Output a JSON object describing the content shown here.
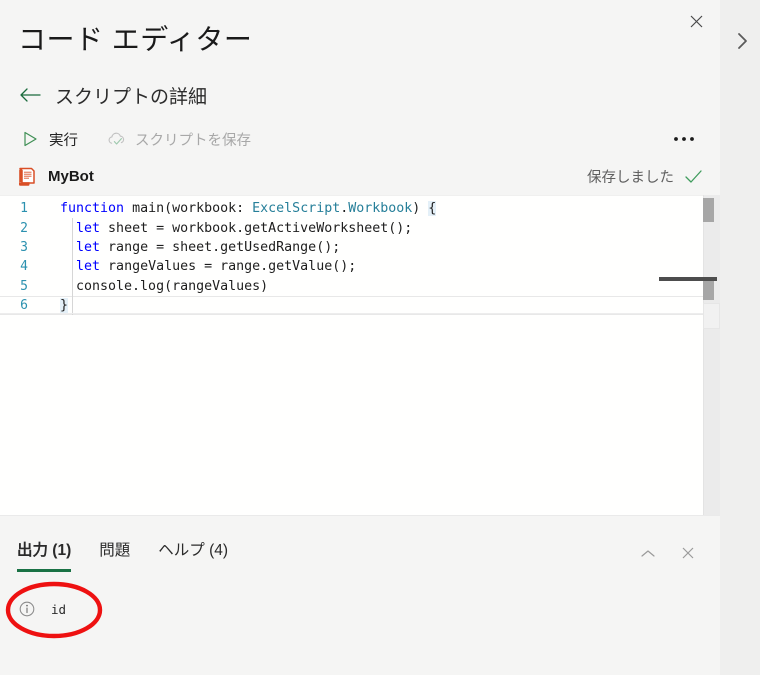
{
  "window": {
    "title": "コード エディター",
    "close_icon": "close-icon"
  },
  "right_rail": {
    "expand_icon": "chevron-right-icon"
  },
  "back_nav": {
    "icon": "arrow-left-icon",
    "label": "スクリプトの詳細"
  },
  "command_bar": {
    "run": {
      "icon": "play-triangle-icon",
      "label": "実行",
      "enabled": true
    },
    "save_script": {
      "icon": "cloud-check-icon",
      "label": "スクリプトを保存",
      "enabled": false
    },
    "overflow": {
      "icon": "ellipsis-icon",
      "label": "•••"
    }
  },
  "script": {
    "icon": "script-document-icon",
    "name": "MyBot",
    "save_state_text": "保存しました",
    "save_state_icon": "checkmark-icon"
  },
  "editor": {
    "language": "typescript",
    "line_numbers": [
      "1",
      "2",
      "3",
      "4",
      "5",
      "6"
    ],
    "lines": [
      {
        "number": "1",
        "tokens": [
          {
            "text": "function ",
            "type": "keyword"
          },
          {
            "text": "main",
            "type": "plain"
          },
          {
            "text": "(workbook: ",
            "type": "plain"
          },
          {
            "text": "ExcelScript",
            "type": "type"
          },
          {
            "text": ".",
            "type": "plain"
          },
          {
            "text": "Workbook",
            "type": "type"
          },
          {
            "text": ") ",
            "type": "plain"
          },
          {
            "text": "{",
            "type": "bracket"
          }
        ]
      },
      {
        "number": "2",
        "tokens": [
          {
            "text": "  ",
            "type": "plain"
          },
          {
            "text": "let",
            "type": "keyword"
          },
          {
            "text": " sheet = workbook.getActiveWorksheet();",
            "type": "plain"
          }
        ]
      },
      {
        "number": "3",
        "tokens": [
          {
            "text": "  ",
            "type": "plain"
          },
          {
            "text": "let",
            "type": "keyword"
          },
          {
            "text": " range = sheet.getUsedRange();",
            "type": "plain"
          }
        ]
      },
      {
        "number": "4",
        "tokens": [
          {
            "text": "  ",
            "type": "plain"
          },
          {
            "text": "let",
            "type": "keyword"
          },
          {
            "text": " rangeValues = range.getValue();",
            "type": "plain"
          }
        ]
      },
      {
        "number": "5",
        "tokens": [
          {
            "text": "  console.log(rangeValues)",
            "type": "plain"
          }
        ]
      },
      {
        "number": "6",
        "tokens": [
          {
            "text": "}",
            "type": "bracket"
          }
        ]
      }
    ]
  },
  "output_panel": {
    "tabs": [
      {
        "label": "出力 (1)",
        "active": true,
        "name": "tab-output"
      },
      {
        "label": "問題",
        "active": false,
        "name": "tab-problems"
      },
      {
        "label": "ヘルプ (4)",
        "active": false,
        "name": "tab-help"
      }
    ],
    "collapse_icon": "chevron-up-icon",
    "close_icon": "close-icon",
    "rows": [
      {
        "icon": "info-circle-icon",
        "text": "id"
      }
    ]
  },
  "annotation": {
    "shape": "ellipse",
    "color": "#ee1111",
    "target": "output-row-id"
  },
  "colors": {
    "accent_green": "#1a7245",
    "panel_bg": "#f5f5f4",
    "editor_bg": "#fffffe",
    "rail_bg": "#efefee",
    "keyword_blue": "#0000ff",
    "type_teal": "#267f99",
    "line_number": "#2b91af",
    "script_icon_orange": "#d94f26",
    "annotation_red": "#ee1111"
  }
}
